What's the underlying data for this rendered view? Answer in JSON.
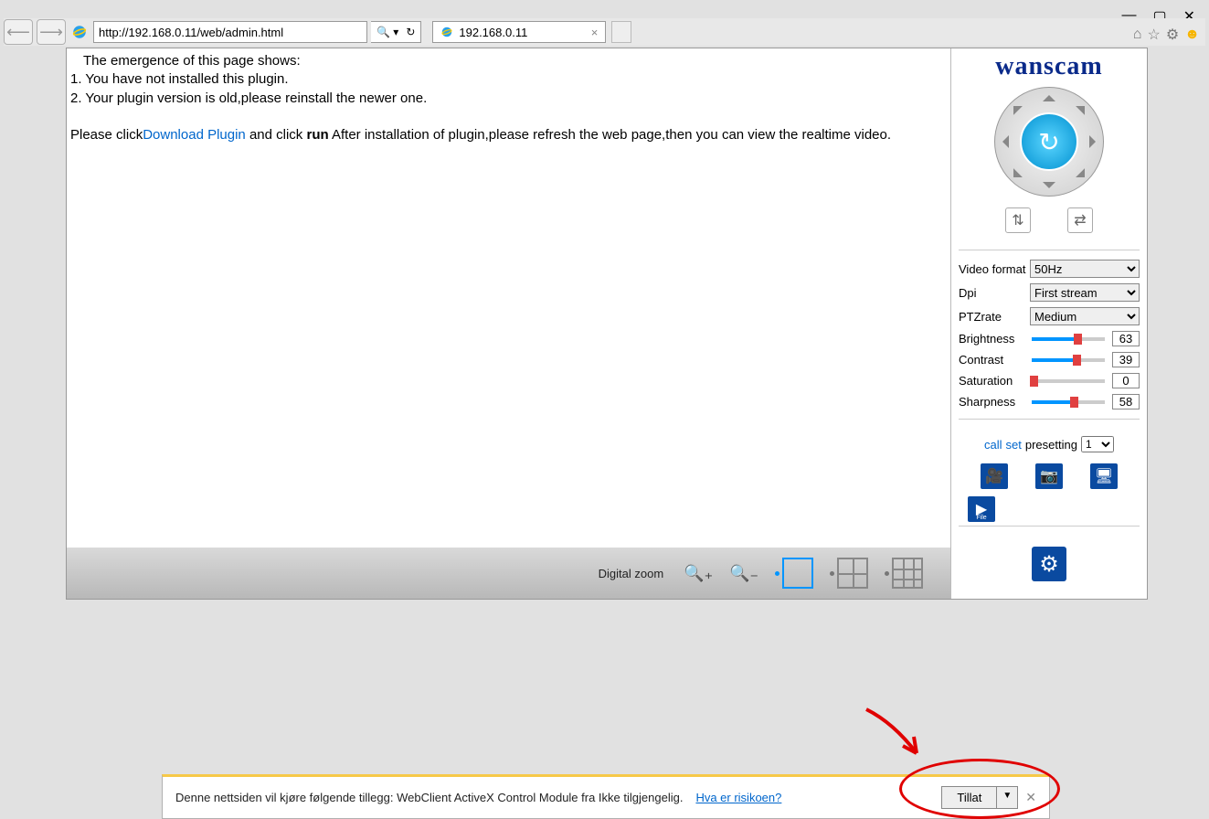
{
  "window": {
    "min": "—",
    "max": "▢",
    "close": "✕"
  },
  "toolbar": {
    "url": "http://192.168.0.11/web/admin.html",
    "tab_title": "192.168.0.11"
  },
  "message": {
    "line0": "The emergence of this page shows:",
    "line1": "1. You have not installed this plugin.",
    "line2": "2. Your plugin version is old,please reinstall the newer one.",
    "pre_link": "Please click",
    "link": "Download Plugin",
    "post_link": " and click ",
    "run": "run",
    "after": " After installation of plugin,please refresh the web page,then you can view the realtime video."
  },
  "bottombar": {
    "digital_zoom": "Digital zoom"
  },
  "sidebar": {
    "logo": "wanscam",
    "video_format_label": "Video format",
    "video_format_value": "50Hz",
    "dpi_label": "Dpi",
    "dpi_value": "First stream",
    "ptzrate_label": "PTZrate",
    "ptzrate_value": "Medium",
    "brightness_label": "Brightness",
    "brightness_val": "63",
    "contrast_label": "Contrast",
    "contrast_val": "39",
    "saturation_label": "Saturation",
    "saturation_val": "0",
    "sharpness_label": "Sharpness",
    "sharpness_val": "58",
    "call": "call",
    "set": "set",
    "presetting": "presetting",
    "preset_val": "1",
    "file_label": "File"
  },
  "addon": {
    "message": "Denne nettsiden vil kjøre følgende tillegg: WebClient ActiveX Control Module fra Ikke tilgjengelig.",
    "risk": "Hva er risikoen?",
    "button": "Tillat"
  }
}
